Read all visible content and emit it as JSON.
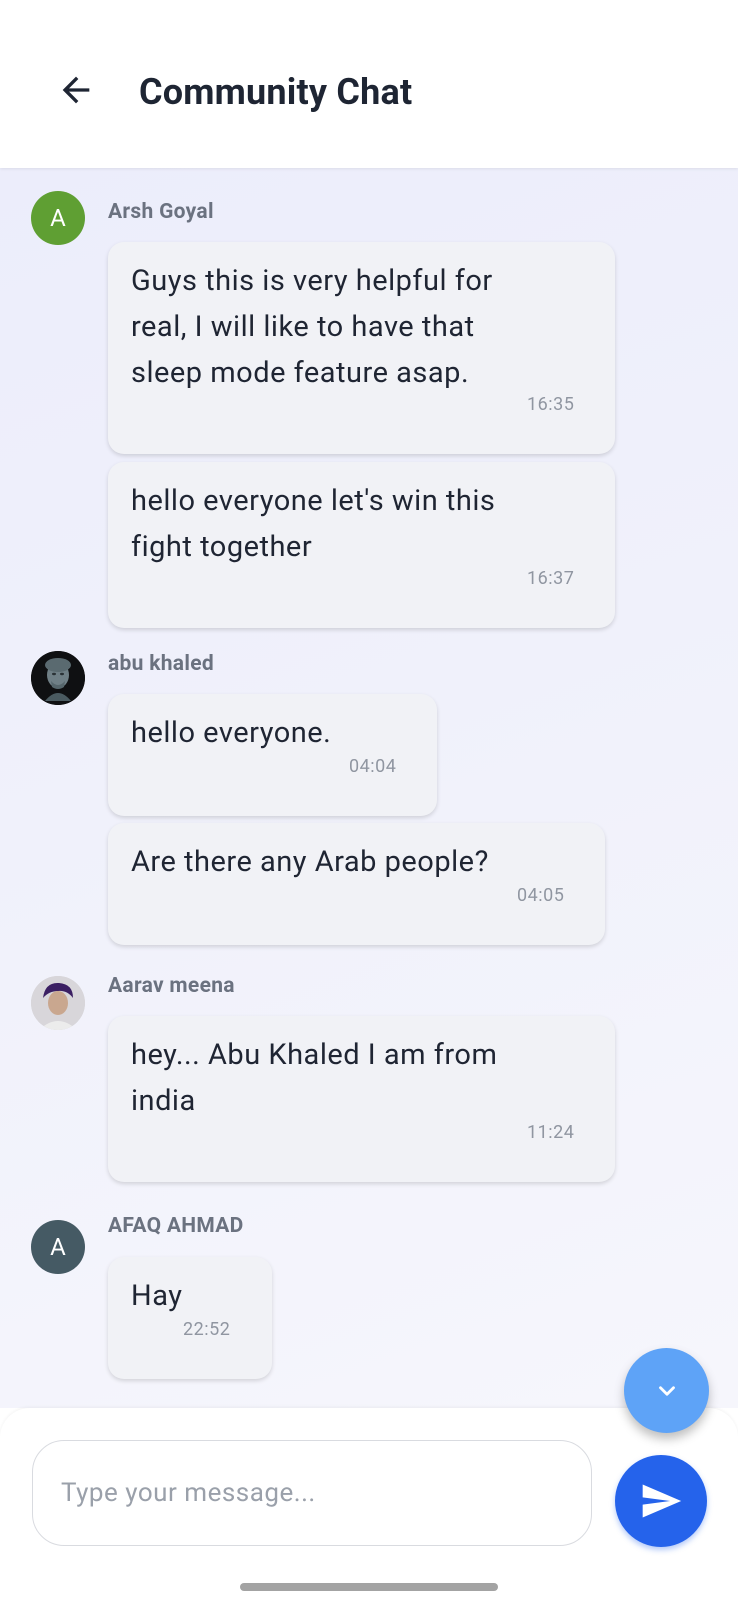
{
  "header": {
    "title": "Community Chat",
    "back_icon": "arrow-left-icon"
  },
  "messages": [
    {
      "sender": "Arsh Goyal",
      "avatar_initial": "A",
      "avatar_color": "#5f9f33",
      "items": [
        {
          "text": "Guys this is very helpful for real, I will like to have that sleep mode feature asap.",
          "time": "16:35"
        },
        {
          "text": "hello everyone let's win this fight together",
          "time": "16:37"
        }
      ]
    },
    {
      "sender": "abu khaled",
      "avatar_initial": "",
      "items": [
        {
          "text": "hello everyone.",
          "time": "04:04"
        },
        {
          "text": "Are there any Arab people?",
          "time": "04:05"
        }
      ]
    },
    {
      "sender": "Aarav meena",
      "avatar_initial": "",
      "items": [
        {
          "text": "hey... Abu Khaled I am from india",
          "time": "11:24"
        }
      ]
    },
    {
      "sender": "AFAQ AHMAD",
      "avatar_initial": "A",
      "avatar_color": "#455a64",
      "items": [
        {
          "text": "Hay",
          "time": "22:52"
        }
      ]
    }
  ],
  "composer": {
    "placeholder": "Type your message...",
    "value": "",
    "send_icon": "send-icon",
    "scroll_icon": "chevron-down-icon"
  },
  "colors": {
    "accent": "#2563eb",
    "scroll_button": "#5ea3f7",
    "bubble": "#f1f2f6"
  }
}
